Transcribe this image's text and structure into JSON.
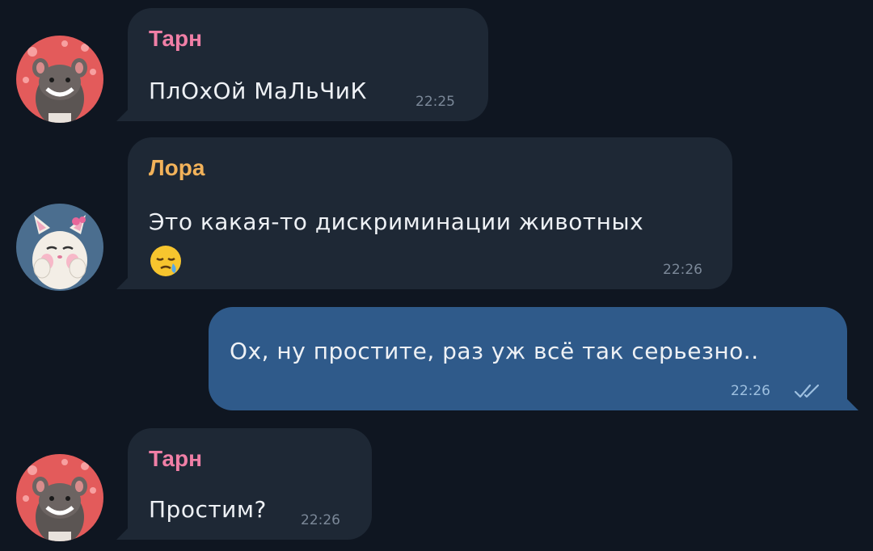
{
  "messages": [
    {
      "sender": "Тарн",
      "sender_color": "#f07fa6",
      "text": "ПлОхОй МаЛьЧиК",
      "time": "22:25",
      "avatar": "rat-avatar"
    },
    {
      "sender": "Лора",
      "sender_color": "#f2b25a",
      "text": "Это какая-то дискриминации животных",
      "emoji": "sleepy-face-emoji",
      "time": "22:26",
      "avatar": "cat-avatar"
    },
    {
      "sender": "",
      "text": "Ох, ну простите, раз уж всё так серьезно..",
      "time": "22:26",
      "status": "read-double-check"
    },
    {
      "sender": "Тарн",
      "sender_color": "#f07fa6",
      "text": "Простим?",
      "time": "22:26",
      "avatar": "rat-avatar"
    }
  ],
  "colors": {
    "background": "#0f1621",
    "incoming_bubble": "#1e2835",
    "outgoing_bubble": "#2f5a8a",
    "check_color": "#9ec0e0"
  }
}
